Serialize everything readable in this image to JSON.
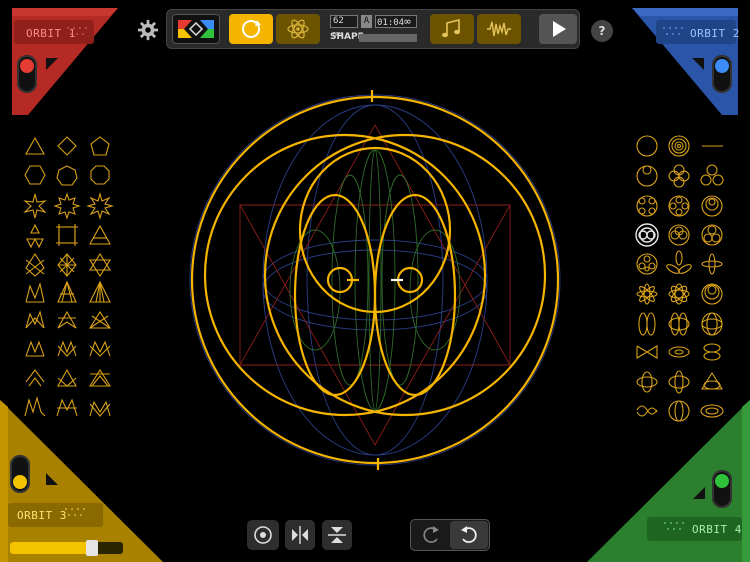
{
  "orbits": [
    {
      "label": "ORBIT 1",
      "color": "#c0302a"
    },
    {
      "label": "ORBIT 2",
      "color": "#2f5db8"
    },
    {
      "label": "ORBIT 3",
      "color": "#d8a800"
    },
    {
      "label": "ORBIT 4",
      "color": "#2f8a32"
    }
  ],
  "topbar": {
    "bpm_value": "62",
    "bpm_unit": "BPM",
    "key": "A",
    "time": "01:04",
    "loop_symbol": "∞",
    "shape_label": "SHAPE"
  },
  "help_label": "?",
  "icons": {
    "settings": "gear-icon",
    "color_palette": "palette-icon",
    "orbit_mode": "orbit-cycle-icon",
    "atom_mode": "atom-icon",
    "music": "music-note-icon",
    "waveform": "waveform-icon",
    "play": "play-icon",
    "center": "target-icon",
    "mirror_h": "mirror-horizontal-icon",
    "mirror_v": "mirror-vertical-icon",
    "rotate_ccw": "rotate-ccw-icon",
    "rotate_cw": "rotate-cw-icon"
  },
  "accent": "#f4b400",
  "orbit3_slider": {
    "value": 0.75
  }
}
